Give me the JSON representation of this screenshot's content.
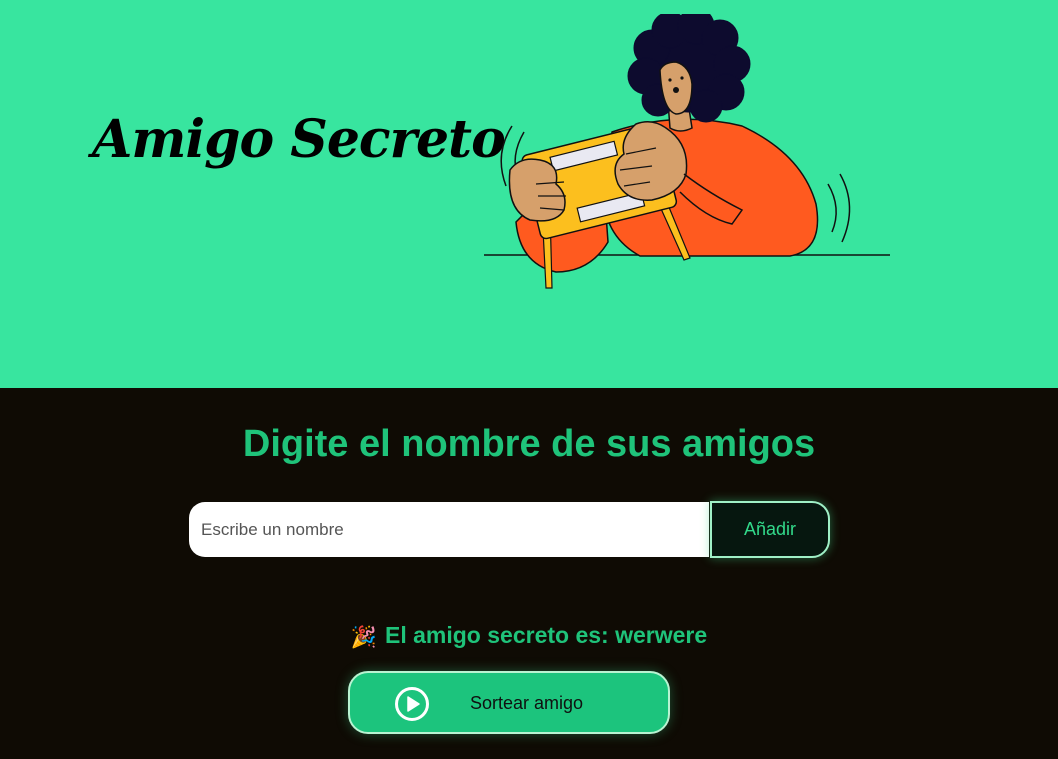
{
  "header": {
    "title": "Amigo Secreto",
    "illustration": "person-opening-gift-illustration"
  },
  "main": {
    "heading": "Digite el nombre de sus amigos",
    "name_input": {
      "value": "",
      "placeholder": "Escribe un nombre"
    },
    "add_button_label": "Añadir",
    "result": {
      "icon": "party-popper-icon",
      "emoji": "🎉",
      "text": "El amigo secreto es: werwere"
    },
    "draw_button": {
      "icon": "play-circle-icon",
      "label": "Sortear amigo"
    }
  },
  "colors": {
    "hero_background": "#38e59f",
    "main_background": "#0f0b04",
    "accent_green": "#1fc37a",
    "button_green": "#1cc47d",
    "illustration_shirt": "#ff5a1f",
    "illustration_box": "#fcbf1e",
    "illustration_hair": "#0d0b2e",
    "illustration_skin": "#d6a06b"
  }
}
